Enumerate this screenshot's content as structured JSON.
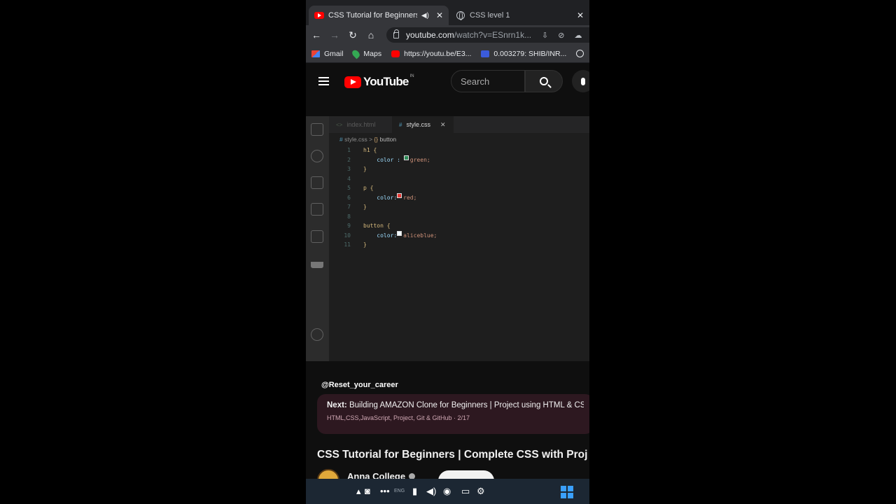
{
  "browser": {
    "tabs": [
      {
        "title": "CSS Tutorial for Beginners | C",
        "active": true,
        "favicon": "youtube-icon"
      },
      {
        "title": "CSS level 1",
        "active": false,
        "favicon": "globe-icon"
      }
    ],
    "url_host": "youtube.com",
    "url_rest": "/watch?v=ESnrn1k...",
    "bookmarks": [
      {
        "label": "Gmail",
        "icon": "gmail-icon"
      },
      {
        "label": "Maps",
        "icon": "maps-icon"
      },
      {
        "label": "https://youtu.be/E3...",
        "icon": "youtube-icon"
      },
      {
        "label": "0.003279: SHIB/INR...",
        "icon": "chart-icon"
      }
    ]
  },
  "youtube": {
    "logo_text": "YouTube",
    "country_code": "IN",
    "search_placeholder": "Search"
  },
  "editor": {
    "tabs": [
      {
        "label": "index.html"
      },
      {
        "label": "style.css"
      }
    ],
    "breadcrumb_file": "style.css",
    "breadcrumb_sep": ">",
    "breadcrumb_symbol": "button",
    "lines": [
      {
        "n": "1",
        "text": "h1 {"
      },
      {
        "n": "2",
        "text": "    color : ",
        "value": "green;",
        "swatch": "#2e8b57"
      },
      {
        "n": "3",
        "text": "}"
      },
      {
        "n": "4",
        "text": ""
      },
      {
        "n": "5",
        "text": "p {"
      },
      {
        "n": "6",
        "text": "    color:",
        "value": "red;",
        "swatch": "#e53935"
      },
      {
        "n": "7",
        "text": "}"
      },
      {
        "n": "8",
        "text": ""
      },
      {
        "n": "9",
        "text": "button {"
      },
      {
        "n": "10",
        "text": "    color:",
        "value": "aliceblue;",
        "swatch": "#f0f8ff"
      },
      {
        "n": "11",
        "text": "}"
      }
    ]
  },
  "overlay": {
    "handle": "@Reset_your_career",
    "next_label": "Next:",
    "next_title": "Building AMAZON Clone for Beginners | Project using HTML & CSS",
    "next_meta": "HTML,CSS,JavaScript, Project, Git & GitHub · 2/17",
    "video_title": "CSS Tutorial for Beginners | Complete CSS with Proj",
    "channel_name": "Anna College"
  },
  "taskbar": {
    "time_fragment": "ENG"
  }
}
